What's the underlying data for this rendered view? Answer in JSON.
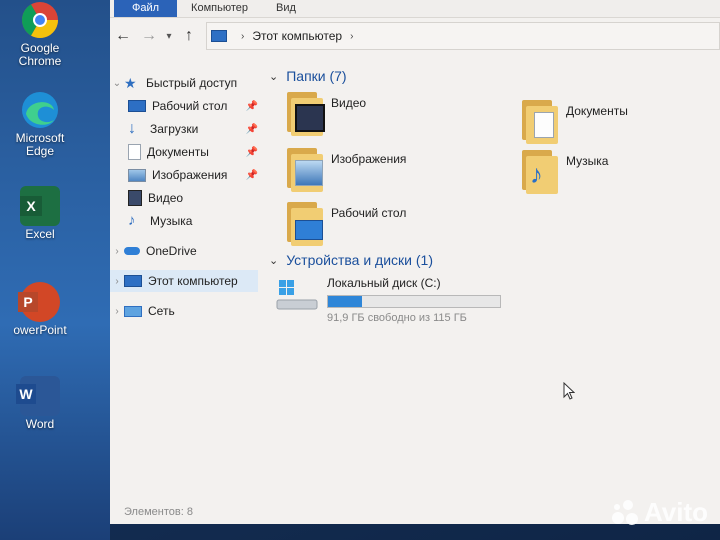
{
  "desktop": {
    "icons": [
      {
        "label": "Google Chrome",
        "line1": "Google",
        "line2": "Chrome",
        "icon": "chrome-icon"
      },
      {
        "label": "Microsoft Edge",
        "line1": "Microsoft",
        "line2": "Edge",
        "icon": "edge-icon"
      },
      {
        "label": "Excel",
        "line1": "Excel",
        "line2": "",
        "icon": "excel-icon"
      },
      {
        "label": "PowerPoint",
        "line1": "owerPoint",
        "line2": "",
        "icon": "powerpoint-icon"
      },
      {
        "label": "Word",
        "line1": "Word",
        "line2": "",
        "icon": "word-icon"
      }
    ]
  },
  "ribbon": {
    "tabs": [
      "Файл",
      "Компьютер",
      "Вид"
    ]
  },
  "address": {
    "path": "Этот компьютер"
  },
  "sidebar": {
    "quick_access": "Быстрый доступ",
    "items": [
      {
        "label": "Рабочий стол",
        "icon": "desktop-icon",
        "pinned": true
      },
      {
        "label": "Загрузки",
        "icon": "download-icon",
        "pinned": true
      },
      {
        "label": "Документы",
        "icon": "documents-icon",
        "pinned": true
      },
      {
        "label": "Изображения",
        "icon": "pictures-icon",
        "pinned": true
      },
      {
        "label": "Видео",
        "icon": "video-icon",
        "pinned": false
      },
      {
        "label": "Музыка",
        "icon": "music-icon",
        "pinned": false
      }
    ],
    "onedrive": "OneDrive",
    "this_pc": "Этот компьютер",
    "network": "Сеть"
  },
  "content": {
    "folders_header": "Папки (7)",
    "folders": [
      {
        "name": "Видео",
        "icon": "video-folder-icon"
      },
      {
        "name": "Документы",
        "icon": "documents-folder-icon"
      },
      {
        "name": "Изображения",
        "icon": "pictures-folder-icon"
      },
      {
        "name": "Музыка",
        "icon": "music-folder-icon"
      },
      {
        "name": "Рабочий стол",
        "icon": "desktop-folder-icon"
      }
    ],
    "devices_header": "Устройства и диски (1)",
    "drive": {
      "name": "Локальный диск (C:)",
      "free_text": "91,9 ГБ свободно из 115 ГБ",
      "used_fraction": 0.2
    }
  },
  "status": {
    "items_count": "Элементов: 8"
  },
  "watermark": "Avito",
  "colors": {
    "accent": "#2b63b8",
    "header": "#1a4f9c",
    "drive_bar": "#2e86d8"
  }
}
